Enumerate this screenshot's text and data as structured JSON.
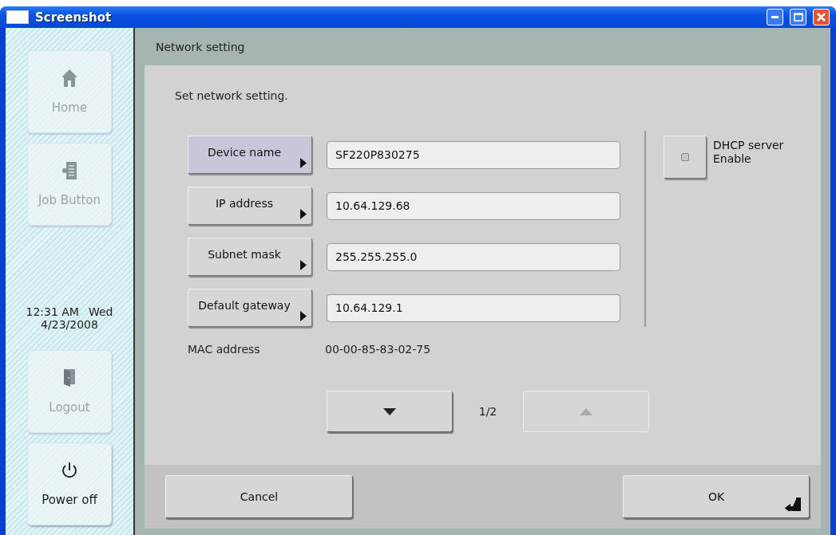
{
  "window": {
    "title": "Screenshot"
  },
  "sidebar": {
    "buttons_top": [
      {
        "label": "Home",
        "kind": "home",
        "disabled": true
      },
      {
        "label": "Job Button",
        "kind": "job",
        "disabled": true
      }
    ],
    "clock": {
      "time": "12:31 AM",
      "weekday": "Wed",
      "date": "4/23/2008"
    },
    "buttons_bottom": [
      {
        "label": "Logout",
        "kind": "logout",
        "disabled": true
      },
      {
        "label": "Power off",
        "kind": "power",
        "disabled": false
      }
    ]
  },
  "panel": {
    "title": "Network setting",
    "instruction": "Set network setting.",
    "settings": [
      {
        "label": "Device name",
        "value": "SF220P830275",
        "selected": true
      },
      {
        "label": "IP address",
        "value": "10.64.129.68",
        "selected": false
      },
      {
        "label": "Subnet mask",
        "value": "255.255.255.0",
        "selected": false
      },
      {
        "label": "Default gateway",
        "value": "10.64.129.1",
        "selected": false
      }
    ],
    "dhcp": {
      "label_lines": [
        "DHCP server",
        "Enable"
      ],
      "checked": false
    },
    "mac": {
      "label": "MAC address",
      "value": "00-00-85-83-02-75"
    },
    "pager": {
      "page": "1/2",
      "buttons": [
        {
          "kind": "down",
          "disabled": false
        },
        {
          "kind": "up",
          "disabled": true
        }
      ]
    }
  },
  "footer": {
    "buttons": [
      {
        "label": "Cancel",
        "kind": "cancel"
      },
      {
        "label": "OK",
        "kind": "ok"
      }
    ]
  }
}
